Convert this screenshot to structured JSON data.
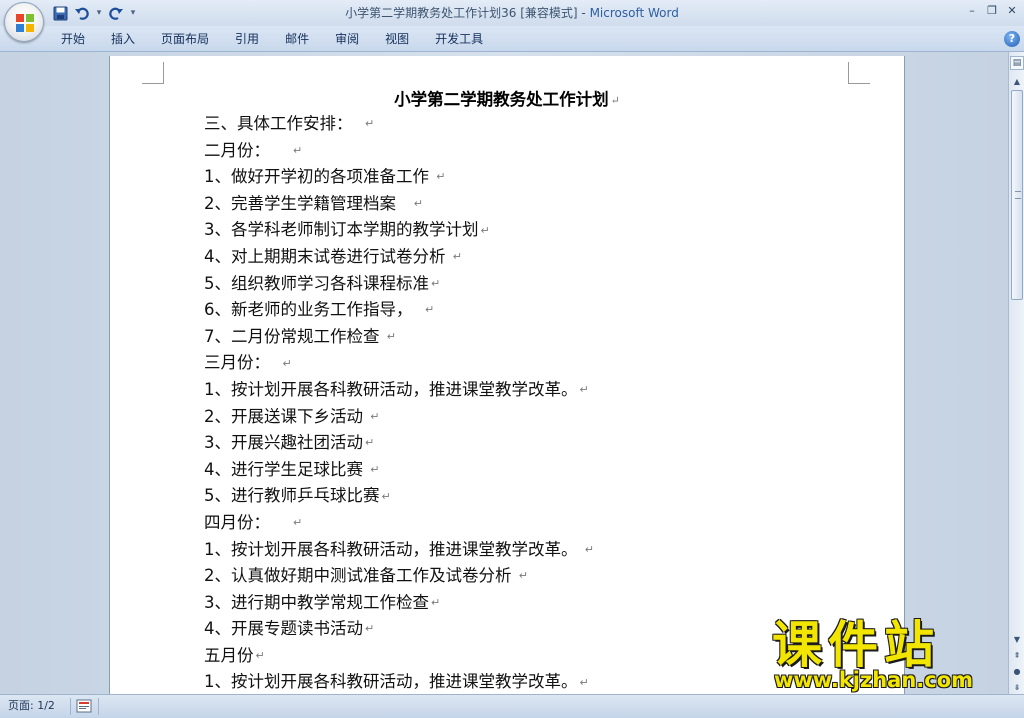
{
  "window": {
    "title": "小学第二学期教务处工作计划36 [兼容模式]",
    "separator": " - ",
    "app_name": "Microsoft Word",
    "controls": [
      "minimize",
      "restore",
      "close"
    ]
  },
  "quick_access": [
    "save-icon",
    "undo-icon",
    "redo-icon",
    "customize-icon"
  ],
  "ribbon": {
    "tabs": [
      "开始",
      "插入",
      "页面布局",
      "引用",
      "邮件",
      "审阅",
      "视图",
      "开发工具"
    ]
  },
  "document": {
    "title": "小学第二学期教务处工作计划",
    "paragraph_mark": "↵",
    "lines": [
      "三、具体工作安排：  ",
      "二月份：    ",
      "1、做好开学初的各项准备工作 ",
      "2、完善学生学籍管理档案   ",
      "3、各学科老师制订本学期的教学计划",
      "4、对上期期末试卷进行试卷分析 ",
      "5、组织教师学习各科课程标准",
      "6、新老师的业务工作指导，  ",
      "7、二月份常规工作检查 ",
      "三月份：  ",
      "1、按计划开展各科教研活动，推进课堂教学改革。",
      "2、开展送课下乡活动 ",
      "3、开展兴趣社团活动",
      "4、进行学生足球比赛 ",
      "5、进行教师乒乓球比赛",
      "四月份：    ",
      "1、按计划开展各科教研活动，推进课堂教学改革。 ",
      "2、认真做好期中测试准备工作及试卷分析 ",
      "3、进行期中教学常规工作检查",
      "4、开展专题读书活动",
      "五月份",
      "1、按计划开展各科教研活动，推进课堂教学改革。"
    ]
  },
  "statusbar": {
    "page_indicator": "页面: 1/2"
  },
  "watermark": {
    "logo_text": "课件站",
    "url": "www.kjzhan.com"
  },
  "colors": {
    "accent": "#2e5ea3",
    "title_text": "#3d5470",
    "watermark": "#f2e600"
  }
}
